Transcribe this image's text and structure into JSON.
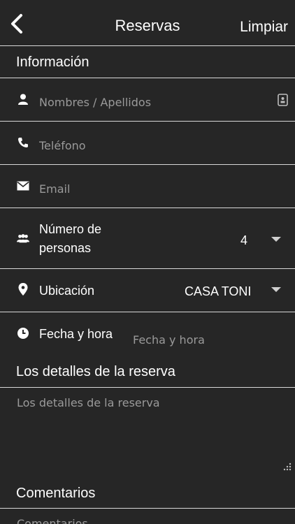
{
  "header": {
    "back_icon": "chevron-left-icon",
    "title": "Reservas",
    "clear_label": "Limpiar"
  },
  "info_section": {
    "title": "Información"
  },
  "fields": {
    "name": {
      "icon": "person-icon",
      "placeholder": "Nombres / Apellidos",
      "contact_icon": "contact-book-icon"
    },
    "phone": {
      "icon": "phone-icon",
      "placeholder": "Teléfono"
    },
    "email": {
      "icon": "envelope-icon",
      "placeholder": "Email"
    },
    "people": {
      "icon": "group-icon",
      "label_line1": "Número de",
      "label_line2": "personas",
      "value": "4"
    },
    "location": {
      "icon": "map-pin-icon",
      "label": "Ubicación",
      "value": "CASA TONI"
    },
    "datetime": {
      "icon": "clock-icon",
      "label": "Fecha y hora",
      "placeholder": "Fecha y hora"
    }
  },
  "details_section": {
    "title": "Los detalles de la reserva",
    "placeholder": "Los detalles de la reserva"
  },
  "comments_section": {
    "title": "Comentarios",
    "placeholder": "Comentarios"
  }
}
